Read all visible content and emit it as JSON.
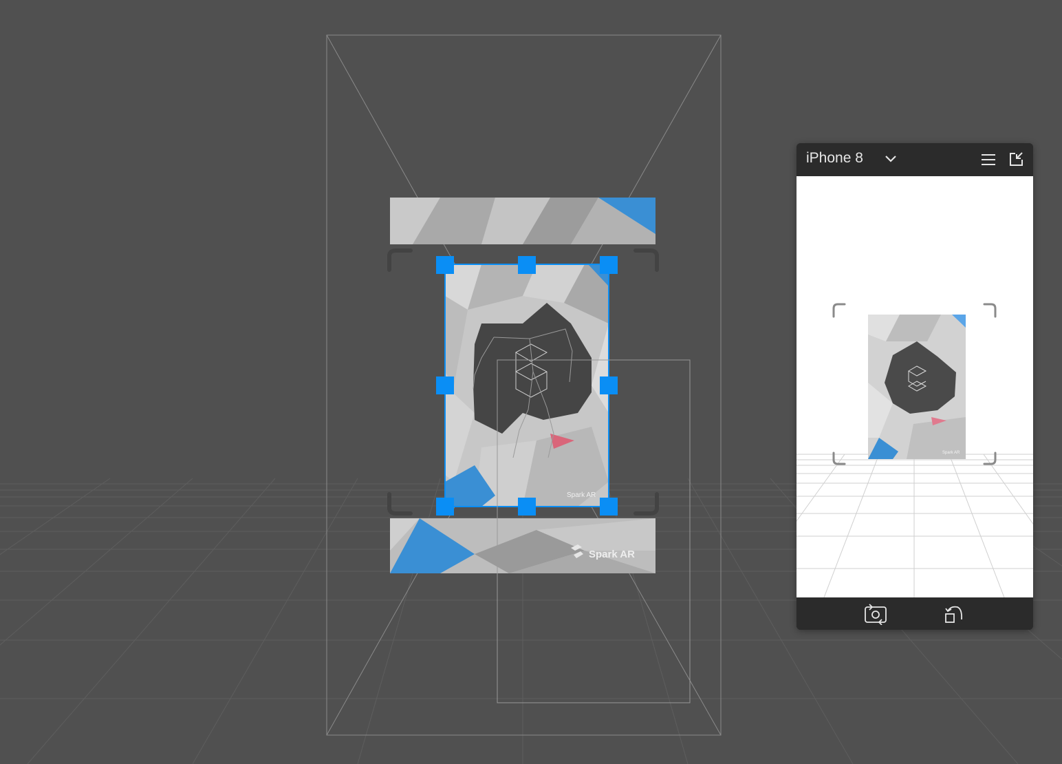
{
  "viewport": {
    "background_color": "#505050",
    "grid_color": "#5f5f5f",
    "selection_color": "#0a8ef5",
    "banner_text": "Spark AR",
    "card_text": "Spark AR",
    "banner_accent": "#3a8fd4",
    "card_accent_pink": "#d9667a"
  },
  "simulator": {
    "device_name": "iPhone 8",
    "device_chevron_icon": "chevron-down-icon",
    "menu_icon": "hamburger-menu-icon",
    "popout_icon": "popout-window-icon",
    "flip_camera_icon": "flip-camera-icon",
    "rotate_icon": "rotate-device-icon",
    "card_text": "Spark AR",
    "screen_background": "#ffffff"
  }
}
